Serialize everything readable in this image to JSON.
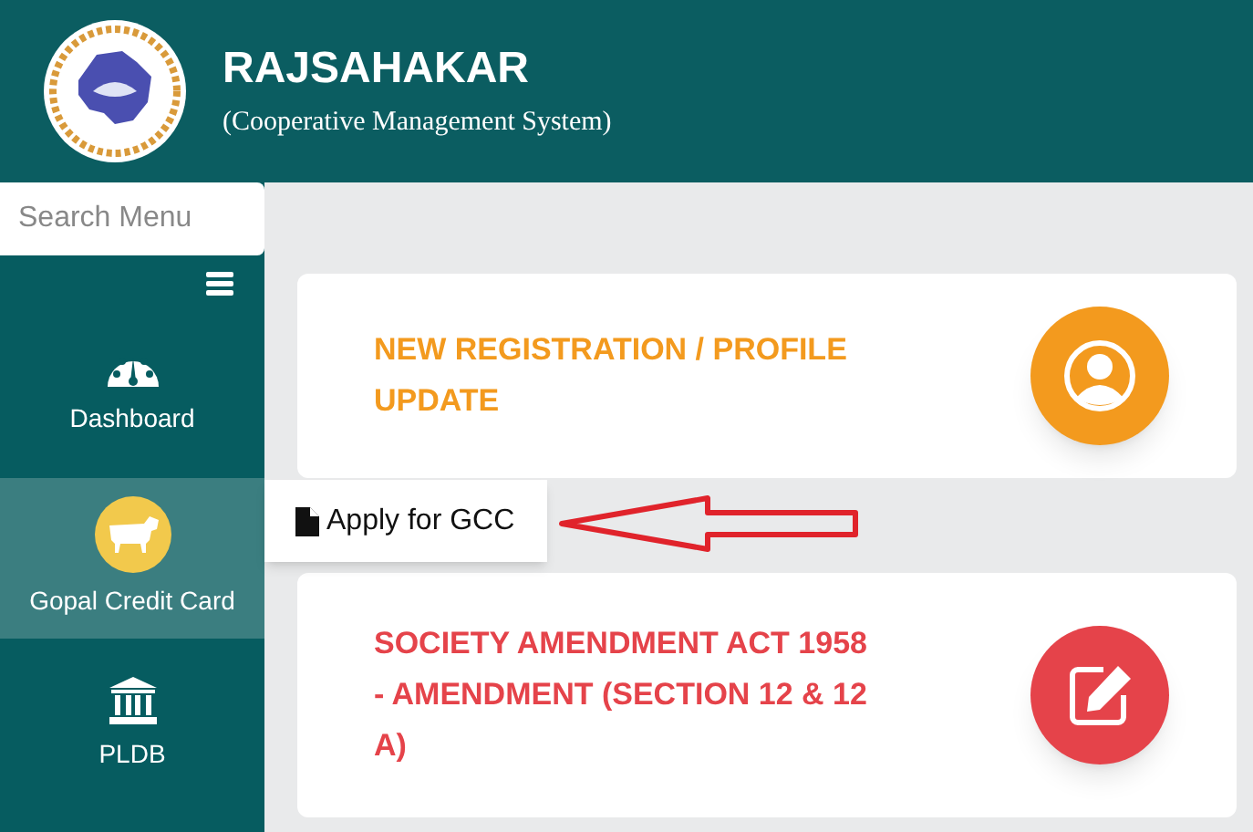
{
  "header": {
    "title": "RAJSAHAKAR",
    "subtitle": "(Cooperative Management System)"
  },
  "sidebar": {
    "search": {
      "placeholder": "Search Menu"
    },
    "items": [
      {
        "label": "Dashboard",
        "kind": "gauge",
        "selected": false
      },
      {
        "label": "Gopal Credit Card",
        "kind": "cow",
        "selected": true
      },
      {
        "label": "PLDB",
        "kind": "bank",
        "selected": false
      }
    ]
  },
  "popup": {
    "label": "Apply for GCC"
  },
  "cards": [
    {
      "title": "NEW REGISTRATION / PROFILE UPDATE",
      "kind": "profile",
      "color": "#f39a1e"
    },
    {
      "title": "SOCIETY AMENDMENT ACT 1958 - AMENDMENT (SECTION 12 & 12 A)",
      "kind": "edit",
      "color": "#e5434a"
    }
  ]
}
